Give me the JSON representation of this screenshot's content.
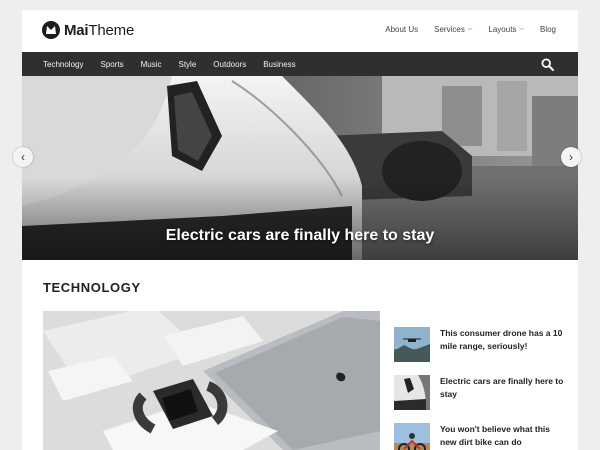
{
  "brand": {
    "name_bold": "Mai",
    "name_light": "Theme"
  },
  "top_nav": [
    {
      "label": "About Us",
      "has_dropdown": false
    },
    {
      "label": "Services",
      "has_dropdown": true
    },
    {
      "label": "Layouts",
      "has_dropdown": true
    },
    {
      "label": "Blog",
      "has_dropdown": false
    }
  ],
  "categories": [
    "Technology",
    "Sports",
    "Music",
    "Style",
    "Outdoors",
    "Business"
  ],
  "hero": {
    "caption": "Electric cars are finally here to stay"
  },
  "slider": {
    "prev": "‹",
    "next": "›"
  },
  "section": {
    "title": "TECHNOLOGY"
  },
  "posts": [
    {
      "title": "This consumer drone has a 10 mile range, seriously!",
      "thumb": "drone"
    },
    {
      "title": "Electric cars are finally here to stay",
      "thumb": "car"
    },
    {
      "title": "You won't believe what this new dirt bike can do",
      "thumb": "dirt-bike"
    }
  ],
  "colors": {
    "nav_bar": "#2f2f2f",
    "page_bg": "#eeeeee"
  }
}
